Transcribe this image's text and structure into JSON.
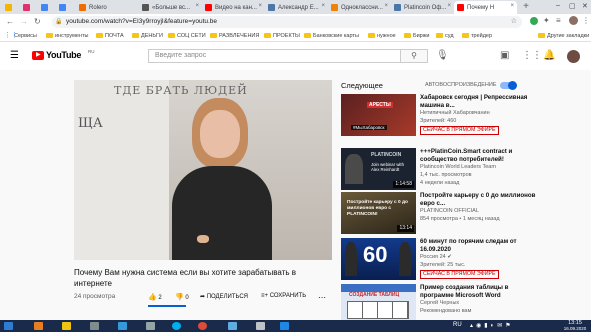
{
  "browser": {
    "tabs": [
      {
        "label": "",
        "favicon_color": "#f4b400"
      },
      {
        "label": "",
        "favicon_color": "#e1306c"
      },
      {
        "label": "",
        "favicon_color": "#4285f4"
      },
      {
        "label": "Rolero",
        "favicon_color": "#ef6c00"
      },
      {
        "label": "«Больше вс...",
        "favicon_color": "#555555"
      },
      {
        "label": "Видео на кан...",
        "favicon_color": "#ff0000"
      },
      {
        "label": "Александр Е...",
        "favicon_color": "#4a76a8"
      },
      {
        "label": "Одноклассни...",
        "favicon_color": "#ee8208"
      },
      {
        "label": "Platincoin Оф...",
        "favicon_color": "#4a76a8"
      },
      {
        "label": "Почему Н",
        "favicon_color": "#ff0000"
      }
    ],
    "url": "youtube.com/watch?v=EI3y9rroyjI&feature=youtu.be",
    "bookmarks": [
      "Сервисы",
      "инструменты",
      "ПОЧТА",
      "ДЕНЬГИ",
      "СОЦ СЕТИ",
      "РАЗВЛЕЧЕНИЯ",
      "ПРОЕКТЫ",
      "Банковские карты",
      "нужное",
      "Биржи",
      "суд",
      "трейдер",
      "Другие закладки"
    ]
  },
  "youtube": {
    "logo": "YouTube",
    "logo_region": "RU",
    "search_placeholder": "Введите запрос"
  },
  "video": {
    "board_text_1": "ТДЕ БРАТЬ ЛЮДЕЙ",
    "board_text_2": "ЩА",
    "title": "Почему Вам нужна система если вы хотите зарабатывать в интернете",
    "views": "24 просмотра",
    "likes": "2",
    "dislikes": "0",
    "share": "ПОДЕЛИТЬСЯ",
    "save": "СОХРАНИТЬ"
  },
  "sidebar": {
    "next_label": "Следующее",
    "autoplay_label": "АВТОВОСПРОИЗВЕДЕНИЕ",
    "autoplay_on": true,
    "items": [
      {
        "title": "Хабаровск сегодня | Репрессивная машина в...",
        "meta1": "Нетипичный Хабаровчанин",
        "meta2": "Зрителей: 460",
        "live": "СЕЙЧАС В ПРЯМОМ ЭФИРЕ",
        "thumb_text": "АРЕСТЫ",
        "thumb_caption": "#МыХабаровск",
        "thumb_color": "#7a1a1a"
      },
      {
        "title": "+++PlatinCoin.Smart contract и сообщество потребителей!",
        "meta1": "Platincoin World Leaders Team",
        "meta2": "1,4 тыс. просмотров",
        "meta3": "4 недели назад",
        "duration": "1:14:58",
        "thumb_text": "PLATINCOIN",
        "thumb_caption": "Join webinar with Alex Reinhardt",
        "thumb_color": "#1b2230"
      },
      {
        "title": "Постройте карьеру с 0 до миллионов евро с...",
        "meta1": "PLATINCOIN OFFICIAL",
        "meta2": "854 просмотра • 1 месяц назад",
        "duration": "13:14",
        "thumb_text": "Постройте карьеру с 0 до миллионов евро с PLATINCOIN!",
        "thumb_color": "#3a3020"
      },
      {
        "title": "60 минут по горячим следам от 16.09.2020",
        "meta1": "Россия 24",
        "meta2": "Зрителей: 25 тыс.",
        "live": "СЕЙЧАС В ПРЯМОМ ЭФИРЕ",
        "thumb_text": "60",
        "thumb_color": "#0e2a6b"
      },
      {
        "title": "Пример создания таблицы в программе Microsoft Word",
        "meta1": "Сергей Черных",
        "meta2": "Рекомендовано вам",
        "thumb_text": "СОЗДАНИЕ ТАБЛИЦ",
        "thumb_color": "#3b6fc4"
      }
    ]
  },
  "taskbar": {
    "lang": "RU",
    "time": "13:15",
    "date": "16.09.2020"
  }
}
